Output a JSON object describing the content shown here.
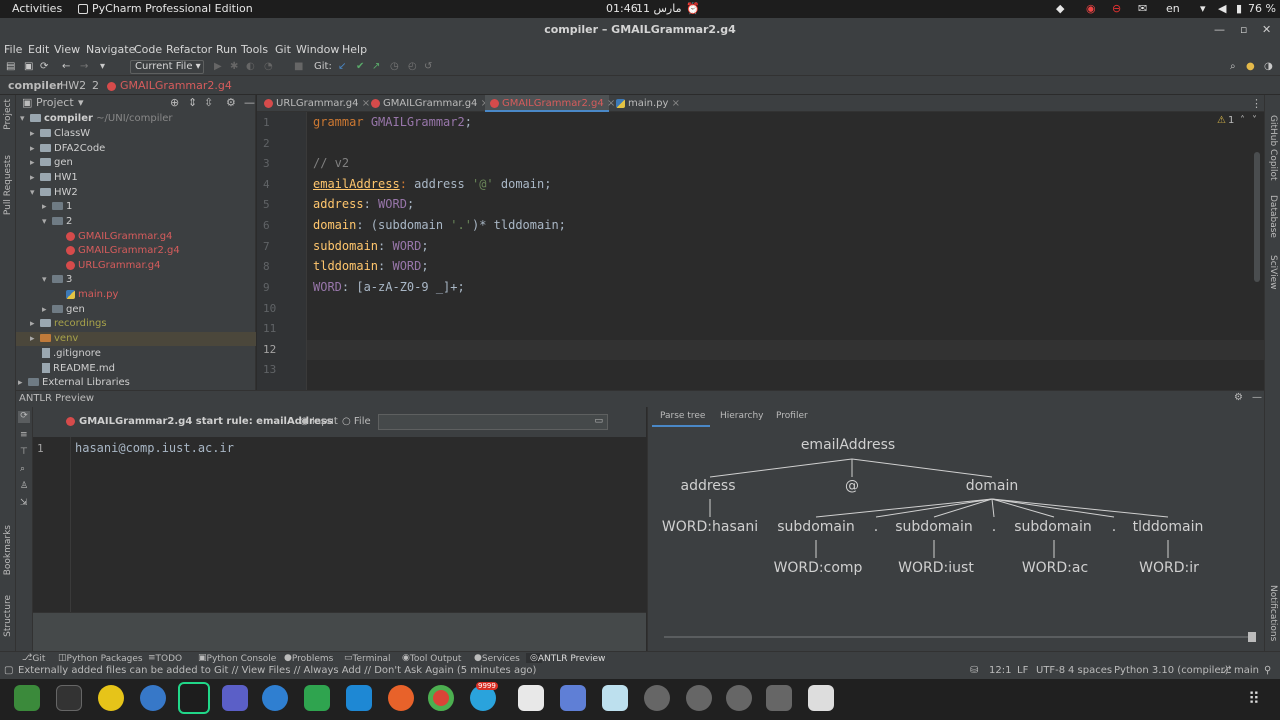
{
  "gnome": {
    "activities": "Activities",
    "app": "PyCharm Professional Edition",
    "clock": "01:46",
    "date": "11 مارس",
    "lang": "en",
    "battery": "76 %"
  },
  "window": {
    "title": "compiler – GMAILGrammar2.g4"
  },
  "menu": [
    "File",
    "Edit",
    "View",
    "Navigate",
    "Code",
    "Refactor",
    "Run",
    "Tools",
    "Git",
    "Window",
    "Help"
  ],
  "toolbar": {
    "run_config": "Current File",
    "git_label": "Git:"
  },
  "breadcrumb": [
    "compiler",
    "HW2",
    "2",
    "GMAILGrammar2.g4"
  ],
  "project": {
    "header": "Project",
    "tree": [
      {
        "label": "compiler",
        "extra": "~/UNI/compiler"
      },
      {
        "label": "ClassW"
      },
      {
        "label": "DFA2Code"
      },
      {
        "label": "gen"
      },
      {
        "label": "HW1"
      },
      {
        "label": "HW2"
      },
      {
        "label": "1"
      },
      {
        "label": "2"
      },
      {
        "label": "GMAILGrammar.g4"
      },
      {
        "label": "GMAILGrammar2.g4"
      },
      {
        "label": "URLGrammar.g4"
      },
      {
        "label": "3"
      },
      {
        "label": "main.py"
      },
      {
        "label": "gen"
      },
      {
        "label": "recordings"
      },
      {
        "label": "venv"
      },
      {
        "label": ".gitignore"
      },
      {
        "label": "README.md"
      },
      {
        "label": "External Libraries"
      }
    ]
  },
  "editor": {
    "tabs": [
      "URLGrammar.g4",
      "GMAILGrammar.g4",
      "GMAILGrammar2.g4",
      "main.py"
    ],
    "active_tab": 2,
    "inspection": "1",
    "lines": [
      "1",
      "2",
      "3",
      "4",
      "5",
      "6",
      "7",
      "8",
      "9",
      "10",
      "11",
      "12",
      "13"
    ]
  },
  "stripes": {
    "left_top": [
      "Project",
      "Pull Requests"
    ],
    "left_bottom": [
      "Bookmarks",
      "Structure"
    ],
    "right": [
      "GitHub Copilot",
      "Database",
      "SciView"
    ],
    "right_bottom": "Notifications"
  },
  "antlr": {
    "panel_title": "ANTLR Preview",
    "start_rule": "GMAILGrammar2.g4 start rule: emailAddress",
    "input_radio": "Input",
    "file_radio": "File",
    "input_line_no": "1",
    "input_text": "hasani@comp.iust.ac.ir",
    "tabs": [
      "Parse tree",
      "Hierarchy",
      "Profiler"
    ],
    "tree": {
      "root": "emailAddress",
      "level1": [
        "address",
        "@",
        "domain"
      ],
      "level2": [
        "WORD:hasani",
        "subdomain",
        ".",
        "subdomain",
        ".",
        "subdomain",
        ".",
        "tlddomain"
      ],
      "level3": [
        "WORD:comp",
        "WORD:iust",
        "WORD:ac",
        "WORD:ir"
      ]
    }
  },
  "tool_tabs": [
    "Git",
    "Python Packages",
    "TODO",
    "Python Console",
    "Problems",
    "Terminal",
    "Tool Output",
    "Services",
    "ANTLR Preview"
  ],
  "status": {
    "message": "Externally added files can be added to Git // View Files // Always Add // Don't Ask Again (5 minutes ago)",
    "position": "12:1",
    "line_sep": "LF",
    "encoding": "UTF-8",
    "indent": "4 spaces",
    "interpreter": "Python 3.10 (compiler)",
    "branch": "main"
  },
  "dock": {
    "badge": "9999"
  }
}
